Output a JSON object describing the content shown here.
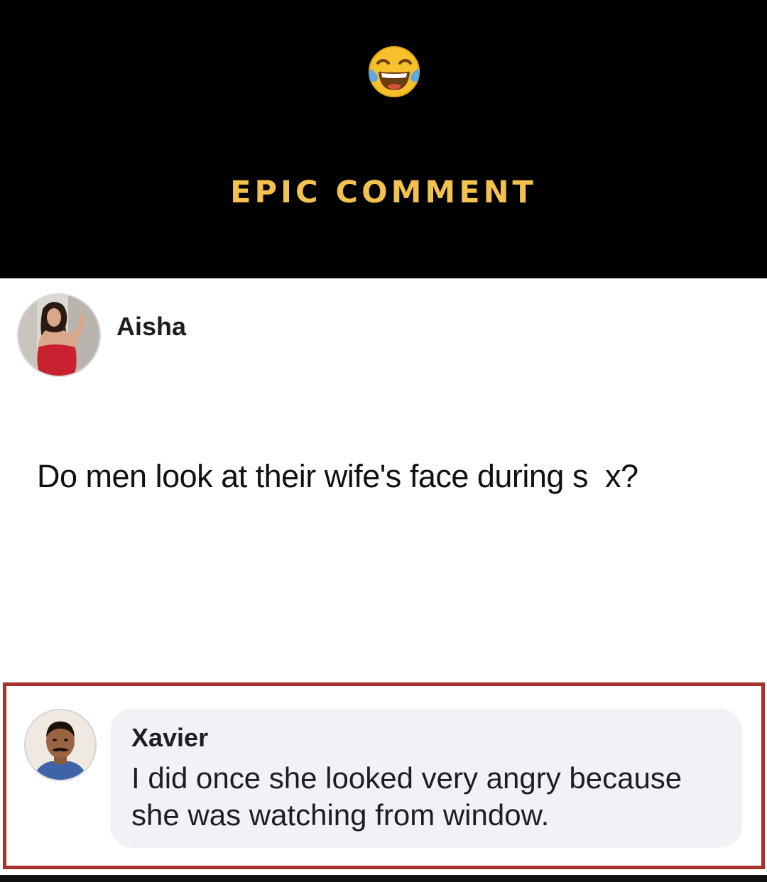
{
  "header": {
    "emoji_icon": "face-with-tears-of-joy-icon",
    "title": "EPIC COMMENT",
    "title_color": "#f2c14e",
    "background": "#000000"
  },
  "post": {
    "author": "Aisha",
    "avatar_icon": "woman-in-red-dress-avatar",
    "text": "Do men look at their wife's face during s  x?"
  },
  "comment": {
    "highlight_color": "#a8302d",
    "author": "Xavier",
    "avatar_icon": "man-with-mustache-avatar",
    "text": "I did once she looked very angry because she was watching from window."
  }
}
